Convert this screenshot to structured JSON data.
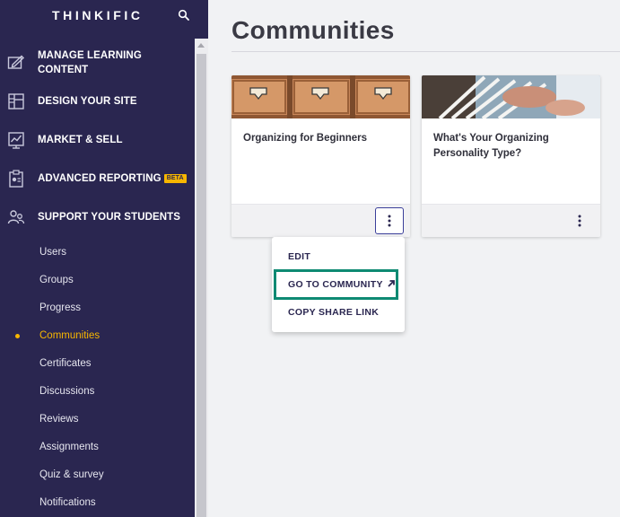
{
  "app": {
    "brand": "THINKIFIC"
  },
  "sidebar": {
    "main_items": [
      {
        "label": "MANAGE LEARNING CONTENT",
        "icon": "edit-content-icon"
      },
      {
        "label": "DESIGN YOUR SITE",
        "icon": "layout-icon"
      },
      {
        "label": "MARKET & SELL",
        "icon": "chart-icon"
      },
      {
        "label": "ADVANCED REPORTING",
        "icon": "clipboard-icon",
        "badge": "BETA"
      },
      {
        "label": "SUPPORT YOUR STUDENTS",
        "icon": "students-icon"
      }
    ],
    "sub_items": [
      {
        "label": "Users"
      },
      {
        "label": "Groups"
      },
      {
        "label": "Progress"
      },
      {
        "label": "Communities",
        "active": true
      },
      {
        "label": "Certificates"
      },
      {
        "label": "Discussions"
      },
      {
        "label": "Reviews"
      },
      {
        "label": "Assignments"
      },
      {
        "label": "Quiz & survey"
      },
      {
        "label": "Notifications"
      }
    ]
  },
  "main": {
    "title": "Communities",
    "cards": [
      {
        "title": "Organizing for Beginners"
      },
      {
        "title": "What's Your Organizing Personality Type?"
      }
    ],
    "menu": {
      "items": [
        "EDIT",
        "GO TO COMMUNITY",
        "COPY SHARE LINK"
      ],
      "highlighted": "GO TO COMMUNITY"
    }
  },
  "colors": {
    "sidebar_bg": "#2a2650",
    "accent": "#f7b600",
    "highlight_border": "#0e8a73"
  }
}
